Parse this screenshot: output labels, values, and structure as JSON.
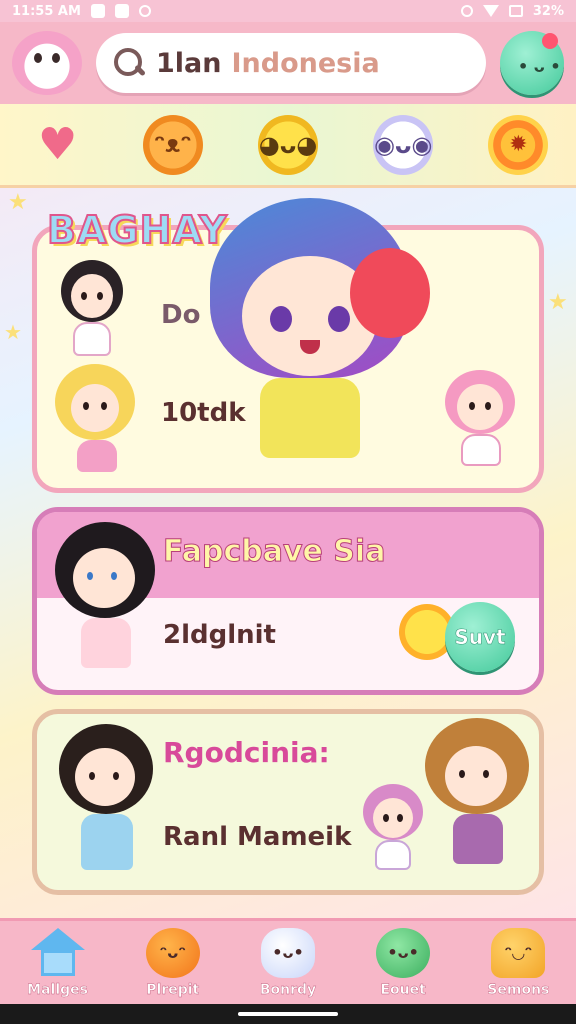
{
  "status_bar": {
    "time": "11:55 AM",
    "battery": "32%"
  },
  "header": {
    "search_prefix": "1lan",
    "search_query": "Indonesia"
  },
  "categories": [
    {
      "icon": "heart-icon"
    },
    {
      "icon": "bear-icon"
    },
    {
      "icon": "chick-icon"
    },
    {
      "icon": "ghost-icon"
    },
    {
      "icon": "sun-icon"
    }
  ],
  "cards": {
    "card1": {
      "badge": "BAGHAY",
      "label": "Do",
      "value": "10tdk"
    },
    "card2": {
      "title": "Fapcbave Sia",
      "value": "2ldglnit",
      "button": "Suvt"
    },
    "card3": {
      "title": "Rgodcinia:",
      "value": "Ranl Mameik"
    }
  },
  "bottom_nav": [
    {
      "label": "Mallges",
      "icon": "home-icon"
    },
    {
      "label": "Plrepit",
      "icon": "orange-icon"
    },
    {
      "label": "Bonrdy",
      "icon": "cloud-icon"
    },
    {
      "label": "Eouet",
      "icon": "apple-icon"
    },
    {
      "label": "Semons",
      "icon": "elephant-icon"
    }
  ],
  "colors": {
    "accent_pink": "#f6b8c8",
    "mint": "#42c99a",
    "card2_band": "#f1a2cf"
  }
}
